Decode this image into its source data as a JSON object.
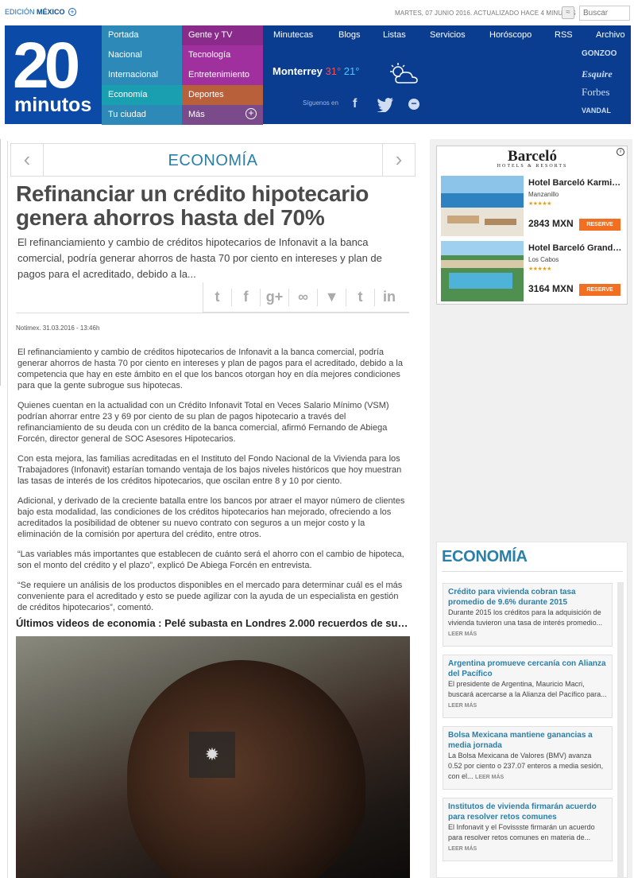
{
  "topbar": {
    "edition_label": "EDICIÓN",
    "edition_country": "MÉXICO",
    "dateline": "MARTES, 07 JUNIO 2016. ACTUALIZADO HACE 4 MINUTOS",
    "search_placeholder": "Buscar"
  },
  "logo": {
    "number": "20",
    "word": "minutos"
  },
  "nav": {
    "col1": [
      "Portada",
      "Nacional",
      "Internacional",
      "Economía",
      "Tu ciudad"
    ],
    "col2": [
      "Gente y TV",
      "Tecnología",
      "Entretenimiento",
      "Deportes",
      "Más"
    ],
    "top": [
      "Minutecas",
      "Blogs",
      "Listas",
      "Servicios",
      "Horóscopo",
      "RSS",
      "Archivo"
    ],
    "colors": {
      "col1": "#2c89b8",
      "col1_active": "#1a9fb0",
      "gente": "#8a2a8a",
      "tecnologia": "#a0309e",
      "entretenimiento": "#a0309e",
      "deportes": "#c05a2a",
      "mas": "#7a4a8a"
    }
  },
  "weather": {
    "city": "Monterrey",
    "high": "31°",
    "low": "21°"
  },
  "social": {
    "follow_label": "Síguenos en"
  },
  "brands": [
    "GONZOO",
    "Esquire",
    "Forbes",
    "VANDAL"
  ],
  "article": {
    "section": "ECONOMÍA",
    "title": "Refinanciar un crédito hipotecario genera ahorros hasta del 70%",
    "lead": "El refinanciamiento y cambio de créditos hipotecarios de Infonavit a la banca comercial, podría generar ahorros de hasta 70 por ciento en intereses y plan de pagos para el acreditado, debido a la...",
    "byline": "Notimex. 31.03.2016 - 13:46h",
    "paragraphs": [
      "El refinanciamiento y cambio de créditos hipotecarios de Infonavit a la banca comercial, podría generar ahorros de hasta 70 por ciento en intereses y plan de pagos para el acreditado, debido a la competencia que hay en este ámbito en el que los bancos otorgan hoy en día mejores condiciones para que la gente subrogue sus hipotecas.",
      "Quienes cuentan en la actualidad con un Crédito Infonavit Total en Veces Salario Mínimo (VSM) podrían ahorrar entre 23 y 69 por ciento de su plan de pagos hipotecario a través del refinanciamiento de su deuda con un crédito de la banca comercial, afirmó Fernando de Abiega Forcén, director general de SOC Asesores Hipotecarios.",
      "Con esta mejora, las familias acreditadas en el Instituto del Fondo Nacional de la Vivienda para los Trabajadores (Infonavit) estarían tomando ventaja de los bajos niveles históricos que hoy muestran las tasas de interés de los créditos hipotecarios, que oscilan entre 8 y 10 por ciento.",
      "Adicional, y derivado de la creciente batalla entre los bancos por atraer el mayor número de clientes bajo esta modalidad, las condiciones de los créditos hipotecarios han mejorado, ofreciendo a los acreditados la posibilidad de obtener su nuevo contrato con seguros a un mejor costo y la eliminación de la comisión por apertura del crédito, entre otros.",
      "“Las variables más importantes que establecen de cuánto será el ahorro con el cambio de hipoteca, son el monto del crédito y el plazo”, explicó De Abiega Forcén en entrevista.",
      "“Se requiere un análisis de los productos disponibles en el mercado para determinar cuál es el más conveniente para el acreditado y esto se puede agilizar con la ayuda de un especialista en gestión de créditos hipotecarios”, comentó."
    ],
    "video_title": "Últimos videos de economia : Pelé subasta en Londres 2.000 recuerdos de su…"
  },
  "ad": {
    "brand": "Barceló",
    "brand_sub": "HOTELS & RESORTS",
    "hotels": [
      {
        "name": "Hotel Barceló Karmin…",
        "location": "Manzanillo",
        "price": "2843 MXN",
        "button": "RESERVE"
      },
      {
        "name": "Hotel Barceló Grand F…",
        "location": "Los Cabos",
        "price": "3164 MXN",
        "button": "RESERVE"
      }
    ]
  },
  "economia": {
    "title": "ECONOMÍA",
    "more_label": "LEER MÁS",
    "items": [
      {
        "title": "Crédito para vivienda cobran tasa promedio de 9.6% durante 2015",
        "desc": "Durante 2015 los créditos para la adquisición de vivienda tuvieron una tasa de interés promedio..."
      },
      {
        "title": "Argentina promueve cercanía con Alianza del Pacífico",
        "desc": "El presidente de Argentina, Mauricio Macri, buscará acercarse a la Alianza del Pacífico para..."
      },
      {
        "title": "Bolsa Mexicana mantiene ganancias a media jornada",
        "desc": "La Bolsa Mexicana de Valores (BMV) avanza 0.52 por ciento o 237.07 enteros a media sesión, con el..."
      },
      {
        "title": "Institutos de vivienda firmarán acuerdo para resolver retos comunes",
        "desc": "El Infonavit y el Fovissste firmarán un acuerdo para resolver retos comunes en materia de..."
      }
    ]
  }
}
